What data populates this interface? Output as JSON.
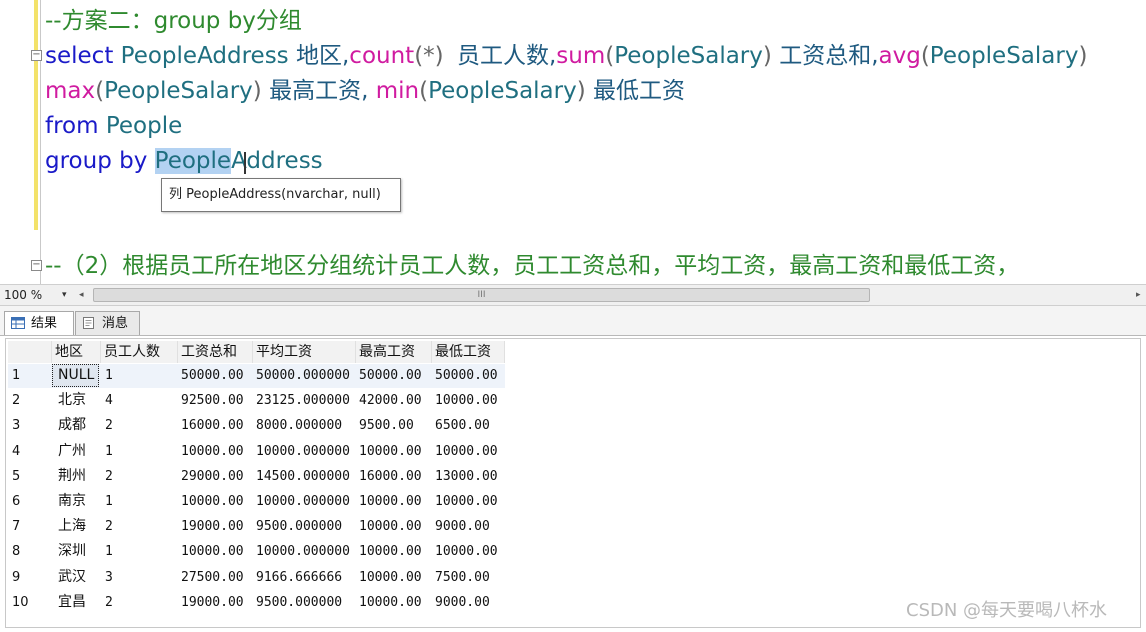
{
  "editor": {
    "comment_top": "--方案二：group by分组",
    "line1": {
      "select": "select",
      "col": "PeopleAddress",
      "alias1": "地区,",
      "count": "count",
      "count_arg": "(*)",
      "alias2": "员工人数,",
      "sum": "sum",
      "sum_open": "(",
      "sum_col": "PeopleSalary",
      "sum_close": ")",
      "alias3": "工资总和,",
      "avg": "avg",
      "avg_open": "(",
      "avg_col": "PeopleSalary",
      "avg_close": ")"
    },
    "line2": {
      "max": "max",
      "max_open": "(",
      "max_col": "PeopleSalary",
      "max_close": ")",
      "alias4": "最高工资,",
      "min": "min",
      "min_open": "(",
      "min_col": "PeopleSalary",
      "min_close": ")",
      "alias5": "最低工资"
    },
    "line3": {
      "from": "from",
      "table": "People"
    },
    "line4": {
      "group_by": "group by",
      "col_selected": "People",
      "col_rest": "Address"
    },
    "tooltip": "列 PeopleAddress(nvarchar, null)",
    "comment_bottom": "--（2）根据员工所在地区分组统计员工人数，员工工资总和，平均工资，最高工资和最低工资，",
    "fold_minus": "−"
  },
  "statusbar": {
    "zoom": "100 %",
    "zoom_arrow": "▾",
    "left_arrow": "◂",
    "right_arrow": "▸",
    "grip": "III"
  },
  "tabs": {
    "results": "结果",
    "messages": "消息"
  },
  "grid": {
    "columns": [
      "地区",
      "员工人数",
      "工资总和",
      "平均工资",
      "最高工资",
      "最低工资"
    ],
    "rows": [
      {
        "n": "1",
        "region": "NULL",
        "count": "1",
        "sum": "50000.00",
        "avg": "50000.000000",
        "max": "50000.00",
        "min": "50000.00"
      },
      {
        "n": "2",
        "region": "北京",
        "count": "4",
        "sum": "92500.00",
        "avg": "23125.000000",
        "max": "42000.00",
        "min": "10000.00"
      },
      {
        "n": "3",
        "region": "成都",
        "count": "2",
        "sum": "16000.00",
        "avg": "8000.000000",
        "max": "9500.00",
        "min": "6500.00"
      },
      {
        "n": "4",
        "region": "广州",
        "count": "1",
        "sum": "10000.00",
        "avg": "10000.000000",
        "max": "10000.00",
        "min": "10000.00"
      },
      {
        "n": "5",
        "region": "荆州",
        "count": "2",
        "sum": "29000.00",
        "avg": "14500.000000",
        "max": "16000.00",
        "min": "13000.00"
      },
      {
        "n": "6",
        "region": "南京",
        "count": "1",
        "sum": "10000.00",
        "avg": "10000.000000",
        "max": "10000.00",
        "min": "10000.00"
      },
      {
        "n": "7",
        "region": "上海",
        "count": "2",
        "sum": "19000.00",
        "avg": "9500.000000",
        "max": "10000.00",
        "min": "9000.00"
      },
      {
        "n": "8",
        "region": "深圳",
        "count": "1",
        "sum": "10000.00",
        "avg": "10000.000000",
        "max": "10000.00",
        "min": "10000.00"
      },
      {
        "n": "9",
        "region": "武汉",
        "count": "3",
        "sum": "27500.00",
        "avg": "9166.666666",
        "max": "10000.00",
        "min": "7500.00"
      },
      {
        "n": "10",
        "region": "宜昌",
        "count": "2",
        "sum": "19000.00",
        "avg": "9500.000000",
        "max": "10000.00",
        "min": "9000.00"
      }
    ]
  },
  "watermark": "CSDN @每天要喝八杯水"
}
